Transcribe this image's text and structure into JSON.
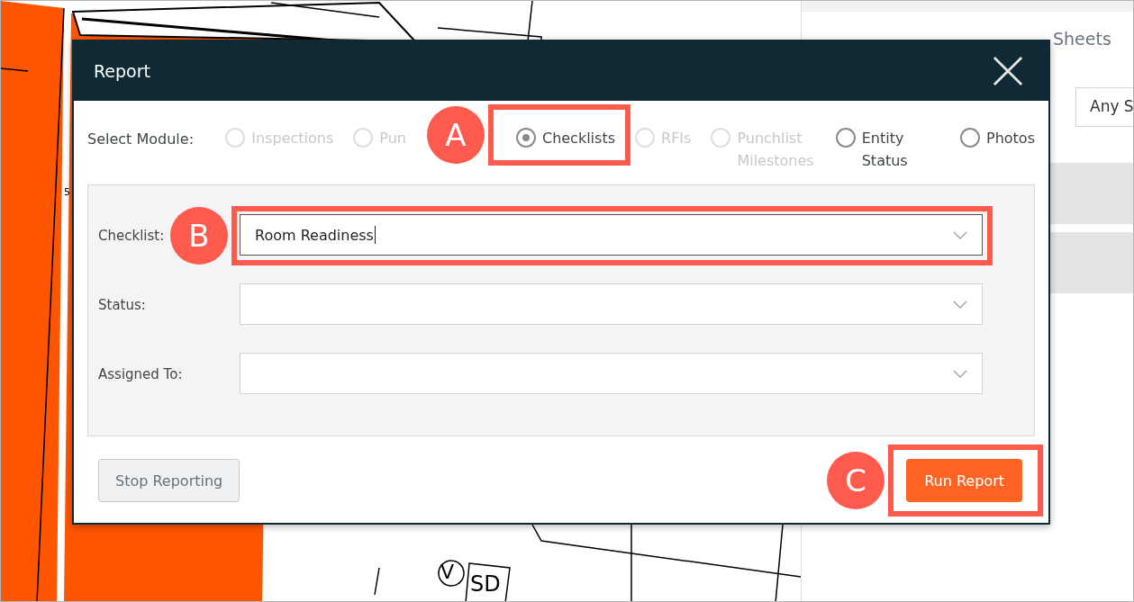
{
  "plan": {
    "labels": [
      {
        "text": "5"
      },
      {
        "text": "V"
      },
      {
        "text": "SD"
      }
    ]
  },
  "side_panel": {
    "tabs": [
      {
        "label": "Sheets",
        "selected": false
      }
    ],
    "filter": {
      "value": "Any S"
    }
  },
  "dialog": {
    "title": "Report",
    "module_label": "Select Module:",
    "modules": [
      {
        "label": "Inspections",
        "selected": false,
        "disabled": true
      },
      {
        "label": "Pun",
        "selected": false,
        "disabled": true
      },
      {
        "label": "Checklists",
        "selected": true,
        "disabled": false
      },
      {
        "label": "RFIs",
        "selected": false,
        "disabled": true
      },
      {
        "label": "Punchlist Milestones",
        "selected": false,
        "disabled": true
      },
      {
        "label": "Entity Status",
        "selected": false,
        "disabled": false
      },
      {
        "label": "Photos",
        "selected": false,
        "disabled": false
      }
    ],
    "fields": [
      {
        "label": "Checklist:",
        "value": "Room Readiness",
        "focused": true
      },
      {
        "label": "Status:",
        "focused": false
      },
      {
        "label": "Assigned To:",
        "focused": false
      }
    ],
    "buttons": [
      {
        "label": "Stop Reporting",
        "kind": "secondary"
      },
      {
        "label": "Run Report",
        "kind": "primary"
      }
    ]
  },
  "callouts": [
    {
      "letter": "A"
    },
    {
      "letter": "B"
    },
    {
      "letter": "C"
    }
  ]
}
